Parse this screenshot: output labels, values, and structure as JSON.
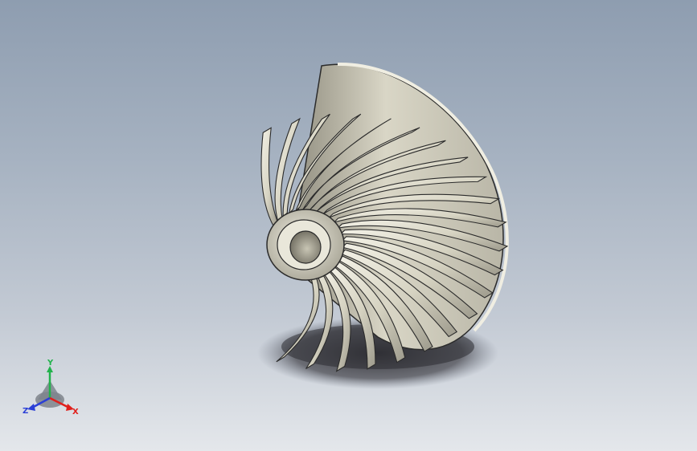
{
  "viewport": {
    "background_top": "#8e9db0",
    "background_bottom": "#e4e7eb",
    "model_color": "#d8d5c4",
    "model_edge_color": "#2b2b2b",
    "shadow_color": "#3a3a3f",
    "model_kind": "impeller",
    "blade_count": 22
  },
  "triad": {
    "x_label": "X",
    "y_label": "Y",
    "z_label": "Z",
    "x_color": "#e0201c",
    "y_color": "#22b24c",
    "z_color": "#2b3fd6"
  }
}
